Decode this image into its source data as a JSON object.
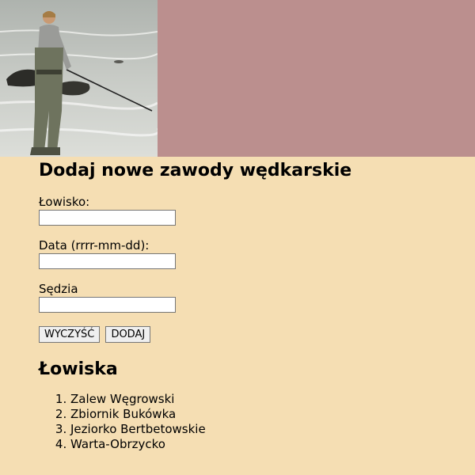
{
  "form": {
    "title": "Dodaj nowe zawody wędkarskie",
    "fields": [
      {
        "label": "Łowisko:",
        "value": "",
        "placeholder": ""
      },
      {
        "label": "Data (rrrr-mm-dd):",
        "value": "",
        "placeholder": ""
      },
      {
        "label": "Sędzia",
        "value": "",
        "placeholder": ""
      }
    ],
    "clear_label": "WYCZYŚĆ",
    "add_label": "DODAJ"
  },
  "fisheries": {
    "heading": "Łowiska",
    "items": [
      "Zalew Węgrowski",
      "Zbiornik Bukówka",
      "Jeziorko Bertbetowskie",
      "Warta-Obrzycko"
    ]
  },
  "colors": {
    "background": "#f5deb3",
    "banner_color": "#bb8f8e"
  }
}
